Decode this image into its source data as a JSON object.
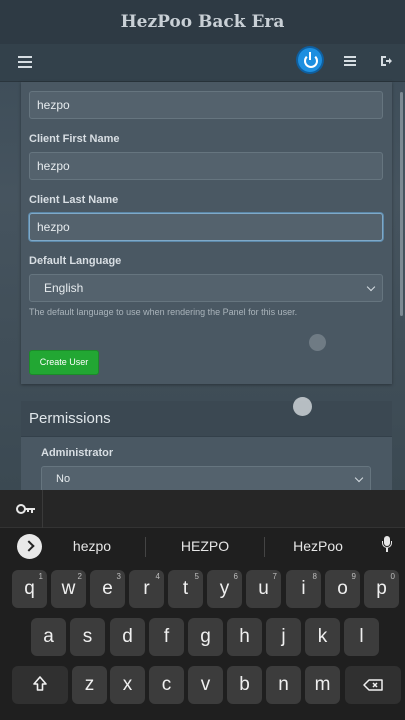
{
  "app": {
    "title": "HezPoo Back Era"
  },
  "form": {
    "top_value": "hezpo",
    "first_name_label": "Client First Name",
    "first_name_value": "hezpo",
    "last_name_label": "Client Last Name",
    "last_name_value": "hezpo",
    "language_label": "Default Language",
    "language_value": "English",
    "language_help": "The default language to use when rendering the Panel for this user.",
    "create_button": "Create User"
  },
  "permissions": {
    "title": "Permissions",
    "admin_label": "Administrator",
    "admin_value": "No"
  },
  "keyboard": {
    "suggestions": [
      "hezpo",
      "HEZPO",
      "HezPoo"
    ],
    "row1": [
      {
        "k": "q",
        "n": "1"
      },
      {
        "k": "w",
        "n": "2"
      },
      {
        "k": "e",
        "n": "3"
      },
      {
        "k": "r",
        "n": "4"
      },
      {
        "k": "t",
        "n": "5"
      },
      {
        "k": "y",
        "n": "6"
      },
      {
        "k": "u",
        "n": "7"
      },
      {
        "k": "i",
        "n": "8"
      },
      {
        "k": "o",
        "n": "9"
      },
      {
        "k": "p",
        "n": "0"
      }
    ],
    "row2": [
      "a",
      "s",
      "d",
      "f",
      "g",
      "h",
      "j",
      "k",
      "l"
    ],
    "row3": [
      "z",
      "x",
      "c",
      "v",
      "b",
      "n",
      "m"
    ]
  },
  "icons": {
    "menu": "hamburger-icon",
    "power": "power-icon",
    "server": "server-list-icon",
    "logout": "logout-icon",
    "key": "key-icon",
    "expand": "chevron-right-icon",
    "mic": "mic-icon",
    "shift": "shift-icon",
    "backspace": "backspace-icon"
  },
  "colors": {
    "create_button": "#22a733",
    "power_button": "#1d8fe0"
  }
}
